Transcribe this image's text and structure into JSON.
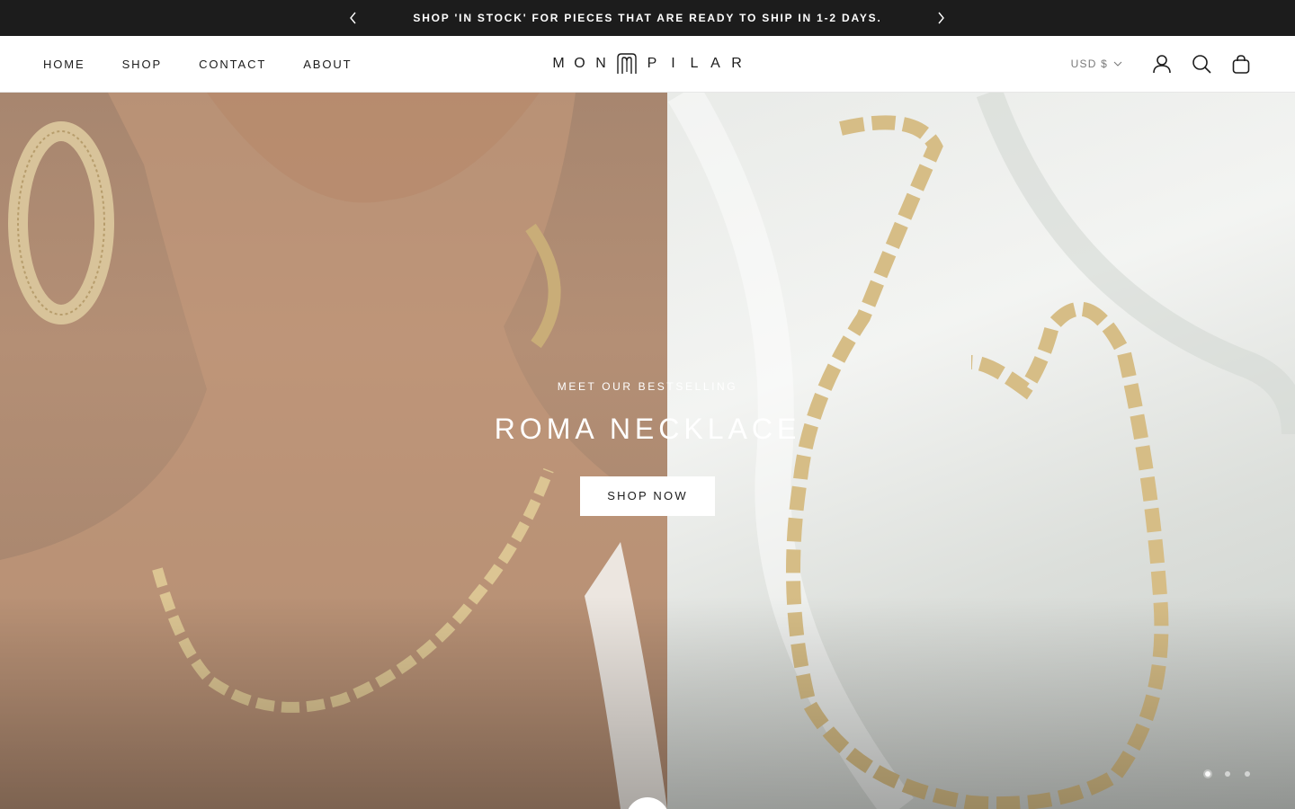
{
  "announcement": {
    "text": "SHOP 'IN STOCK' FOR PIECES THAT ARE READY TO SHIP IN 1-2 DAYS.",
    "prev_icon": "chevron-left-icon",
    "next_icon": "chevron-right-icon"
  },
  "header": {
    "nav": [
      "HOME",
      "SHOP",
      "CONTACT",
      "ABOUT"
    ],
    "logo_left": [
      "M",
      "O",
      "N"
    ],
    "logo_right": [
      "P",
      "I",
      "L",
      "A",
      "R"
    ],
    "currency": "USD $",
    "icons": [
      "account-icon",
      "search-icon",
      "cart-icon"
    ]
  },
  "hero": {
    "eyebrow": "MEET OUR BESTSELLING",
    "title": "ROMA NECKLACE",
    "button": "SHOP NOW",
    "slides": 3,
    "active_slide": 1
  },
  "colors": {
    "announcement_bg": "#1c1c1c",
    "text": "#1c1c1c",
    "hero_left": "#b48f75",
    "hero_right": "#eef0ed"
  }
}
